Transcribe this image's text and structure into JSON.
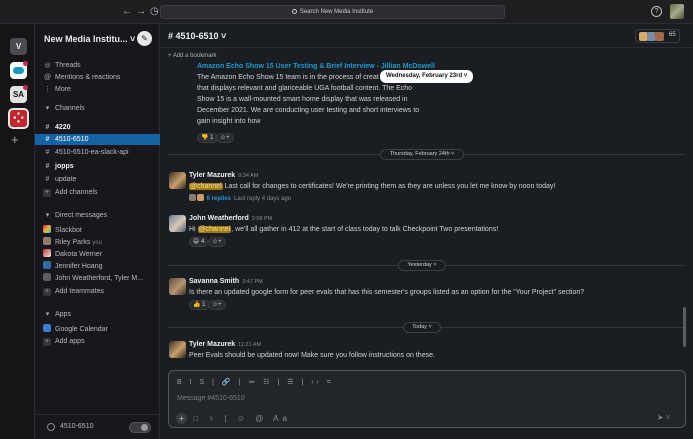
{
  "topbar": {
    "nav_back": "←",
    "nav_forward": "→",
    "history": "◷",
    "search_placeholder": "Search New Media Institute",
    "help": "?"
  },
  "rail": {
    "workspaces": [
      "V",
      "SA"
    ],
    "add": "+"
  },
  "sidebar": {
    "workspace_name": "New Media Institu... ˅",
    "items_top": [
      {
        "icon": "threads-icon",
        "glyph": "◎",
        "label": "Threads"
      },
      {
        "icon": "at-icon",
        "glyph": "@",
        "label": "Mentions & reactions"
      },
      {
        "icon": "more-icon",
        "glyph": "⋮",
        "label": "More"
      }
    ],
    "channels_header": "Channels",
    "channels": [
      {
        "label": "4220",
        "bold": true,
        "active": false
      },
      {
        "label": "4510-6510",
        "bold": true,
        "active": true
      },
      {
        "label": "4510-6510-ea-slack-api",
        "bold": false,
        "active": false
      },
      {
        "label": "jopps",
        "bold": true,
        "active": false
      },
      {
        "label": "update",
        "bold": false,
        "active": false
      }
    ],
    "add_channels": "Add channels",
    "dm_header": "Direct messages",
    "dms": [
      {
        "label": "Slackbot",
        "you": ""
      },
      {
        "label": "Riley Parks",
        "you": "you"
      },
      {
        "label": "Dakota Werner",
        "you": ""
      },
      {
        "label": "Jennifer Hoang",
        "you": ""
      },
      {
        "label": "John Weatherford, Tyler M...",
        "you": ""
      }
    ],
    "add_teammates": "Add teammates",
    "apps_header": "Apps",
    "apps": [
      {
        "label": "Google Calendar"
      }
    ],
    "add_apps": "Add apps",
    "huddle_label": "4510-6510"
  },
  "channel": {
    "title": "# 4510-6510 ˅",
    "member_count": "65",
    "add_bookmark": "+ Add a bookmark",
    "floating_date": "Wednesday, February 23rd ˅",
    "first_message": {
      "title": "Amazon Echo Show 15 User Testing & Brief Interview - Jillian McDowell",
      "lines": [
        "The Amazon Echo Show 15 team is in the process of creat",
        "that displays relevant and glanceable UGA football content. The Echo",
        "Show 15 is a wall-mounted smart home display that was released in",
        "December 2021. We are conducting user testing and short interviews to",
        "gain insight into how"
      ],
      "reaction_count": "1"
    },
    "dates": {
      "thu": "Thursday, February 24th ˅",
      "yesterday": "Yesterday ˅",
      "today": "Today ˅"
    },
    "messages": [
      {
        "author": "Tyler Mazurek",
        "time": "9:34 AM",
        "mention": "@channel",
        "text": " Last call for changes to certificates! We're printing them as they are unless you let me know by noon today!",
        "replies": "6 replies",
        "replies_ago": "Last reply 4 days ago"
      },
      {
        "author": "John Weatherford",
        "time": "2:08 PM",
        "prefix": "Hi ",
        "mention": "@channel",
        "text": ", we'll all gather in 412 at the start of class today to talk Checkpoint Two presentations!",
        "reaction_count": "4"
      },
      {
        "author": "Savanna Smith",
        "time": "3:47 PM",
        "text": "Is there an updated google form for peer evals that has this semester's groups listed as an option for the \"Your Project\" section?",
        "reaction_count": "1"
      },
      {
        "author": "Tyler Mazurek",
        "time": "11:21 AM",
        "text": "Peer Evals should be updated now! Make sure you follow instructions on these."
      }
    ]
  },
  "composer": {
    "placeholder": "Message #4510-6510",
    "format_bar": "B I S | 🔗 | ≔ ☷ | ☰ | ‹› ⌗",
    "tools": "□ ♀ | ☺ @ Aa",
    "send": "➤ ˅"
  },
  "colors": {
    "accent": "#1264a3",
    "link": "#1d9bd1",
    "mention_bg": "#a0790f",
    "background": "#1a1d21"
  }
}
